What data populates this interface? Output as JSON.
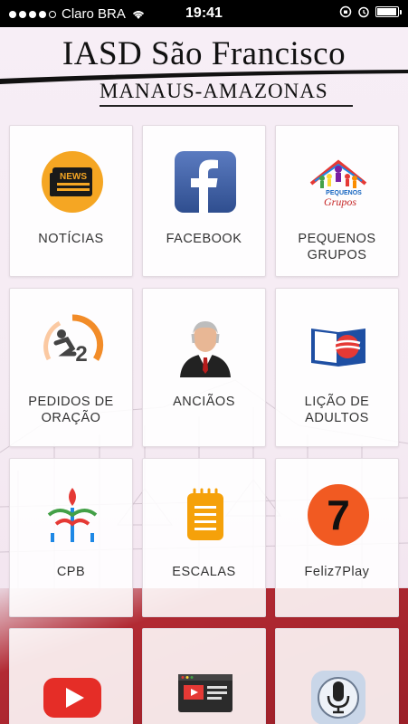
{
  "status_bar": {
    "carrier": "Claro BRA",
    "time": "19:41",
    "signal_bars": 4,
    "signal_total": 5,
    "battery_level": 0.95
  },
  "header": {
    "title": "IASD São Francisco",
    "subtitle": "MANAUS-AMAZONAS"
  },
  "tiles": [
    {
      "label": "NOTÍCIAS",
      "icon": "news-icon"
    },
    {
      "label": "FACEBOOK",
      "icon": "facebook-icon"
    },
    {
      "label": "PEQUENOS\nGRUPOS",
      "icon": "pequenos-grupos-icon",
      "icon_text": "PEQUENOS",
      "icon_script": "Grupos"
    },
    {
      "label": "PEDIDOS DE\nORAÇÃO",
      "icon": "prayer-icon"
    },
    {
      "label": "ANCIÃOS",
      "icon": "elder-icon"
    },
    {
      "label": "LIÇÃO DE\nADULTOS",
      "icon": "lesson-book-icon"
    },
    {
      "label": "CPB",
      "icon": "cpb-icon"
    },
    {
      "label": "ESCALAS",
      "icon": "schedule-notepad-icon"
    },
    {
      "label": "Feliz7Play",
      "icon": "feliz7play-icon",
      "icon_text": "7"
    },
    {
      "label": "",
      "icon": "youtube-icon"
    },
    {
      "label": "",
      "icon": "video-player-icon"
    },
    {
      "label": "",
      "icon": "microphone-icon"
    }
  ],
  "icon_text": {
    "news": "NEWS",
    "cpb_number": "2"
  },
  "colors": {
    "status_bar": "#000000",
    "accent_red": "#b22a33",
    "news_orange": "#f5a623",
    "facebook_blue": "#3b5998",
    "feliz7_orange": "#f15a22",
    "escalas_orange": "#f5a10a"
  }
}
